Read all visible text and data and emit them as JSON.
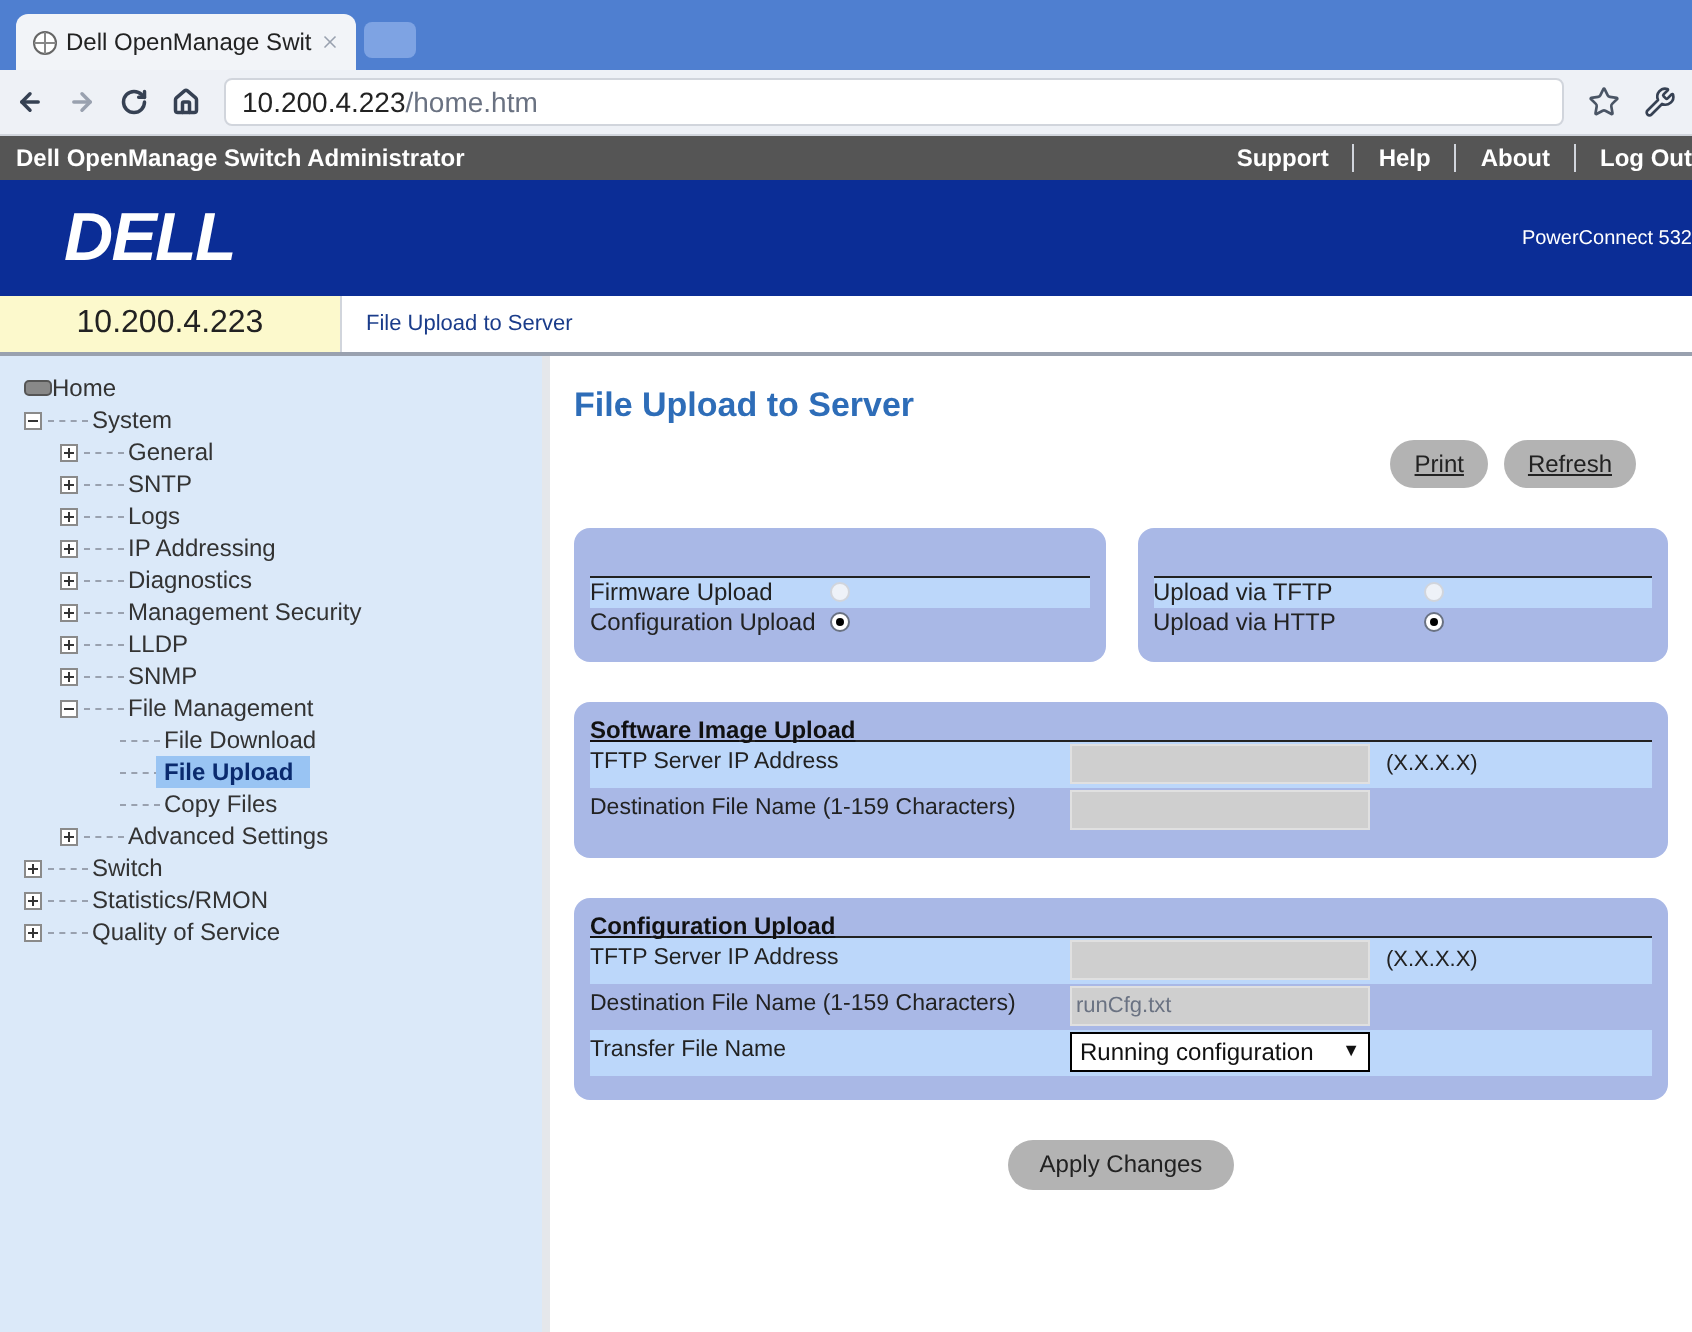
{
  "browser": {
    "tab_title": "Dell OpenManage Swit",
    "url_host": "10.200.4.223",
    "url_path": "/home.htm"
  },
  "header": {
    "title": "Dell OpenManage Switch Administrator",
    "links": [
      "Support",
      "Help",
      "About",
      "Log Out"
    ],
    "logo": "DELL",
    "product": "PowerConnect 532"
  },
  "address_label": "10.200.4.223",
  "breadcrumb": "File Upload to Server",
  "tree": {
    "label": "Home",
    "selected": false,
    "children": [
      {
        "label": "System",
        "expanded": true,
        "selected": false,
        "children": [
          {
            "label": "General",
            "expanded": false,
            "selected": false
          },
          {
            "label": "SNTP",
            "expanded": false,
            "selected": false
          },
          {
            "label": "Logs",
            "expanded": false,
            "selected": false
          },
          {
            "label": "IP Addressing",
            "expanded": false,
            "selected": false
          },
          {
            "label": "Diagnostics",
            "expanded": false,
            "selected": false
          },
          {
            "label": "Management Security",
            "expanded": false,
            "selected": false
          },
          {
            "label": "LLDP",
            "expanded": false,
            "selected": false
          },
          {
            "label": "SNMP",
            "expanded": false,
            "selected": false
          },
          {
            "label": "File Management",
            "expanded": true,
            "selected": false,
            "children": [
              {
                "label": "File Download",
                "selected": false
              },
              {
                "label": "File Upload",
                "selected": true
              },
              {
                "label": "Copy Files",
                "selected": false
              }
            ]
          },
          {
            "label": "Advanced Settings",
            "expanded": false,
            "selected": false
          }
        ]
      },
      {
        "label": "Switch",
        "expanded": false,
        "selected": false
      },
      {
        "label": "Statistics/RMON",
        "expanded": false,
        "selected": false
      },
      {
        "label": "Quality of Service",
        "expanded": false,
        "selected": false
      }
    ]
  },
  "page_title": "File Upload to Server",
  "top_buttons": [
    "Print",
    "Refresh"
  ],
  "radio_groups": [
    [
      {
        "label": "Firmware Upload",
        "selected": false
      },
      {
        "label": "Configuration Upload",
        "selected": true
      }
    ],
    [
      {
        "label": "Upload via TFTP",
        "selected": false
      },
      {
        "label": "Upload via HTTP",
        "selected": true
      }
    ]
  ],
  "sections": [
    {
      "title": "Software Image Upload",
      "rows": [
        {
          "kind": "input",
          "label": "TFTP Server IP Address",
          "value": "",
          "hint": "(X.X.X.X)"
        },
        {
          "kind": "input",
          "label": "Destination File Name (1-159 Characters)",
          "value": ""
        }
      ]
    },
    {
      "title": "Configuration Upload",
      "rows": [
        {
          "kind": "input",
          "label": "TFTP Server IP Address",
          "value": "",
          "hint": "(X.X.X.X)"
        },
        {
          "kind": "input",
          "label": "Destination File Name (1-159 Characters)",
          "value": "runCfg.txt"
        },
        {
          "kind": "select",
          "label": "Transfer File Name",
          "value": "Running configuration",
          "arrow": "▼"
        }
      ]
    }
  ],
  "apply_button": "Apply Changes"
}
